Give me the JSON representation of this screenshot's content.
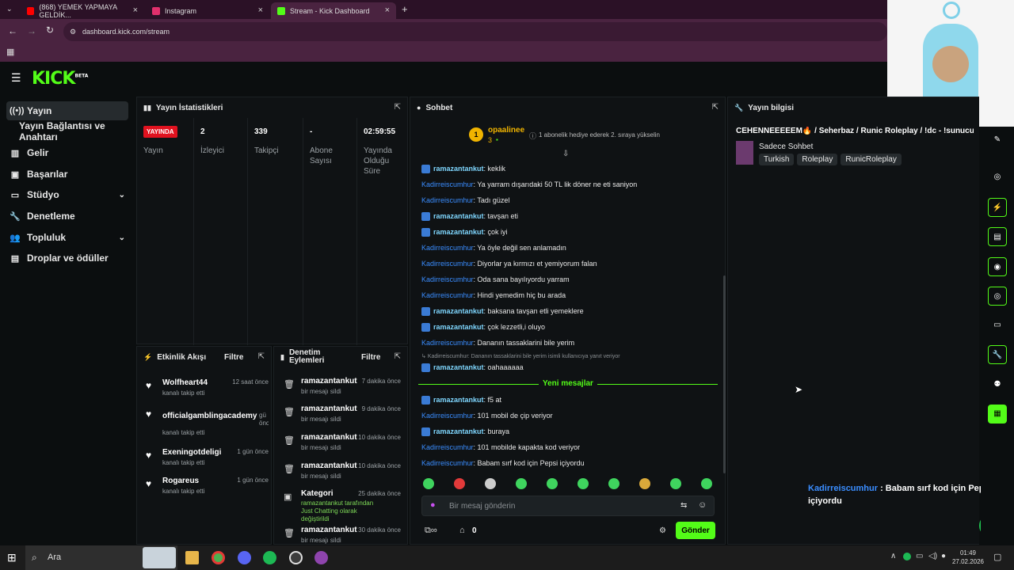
{
  "browser": {
    "tabs": [
      {
        "title": "(868) YEMEK YAPMAYA GELDİK...",
        "icon": "youtube-icon",
        "color": "#ff0000"
      },
      {
        "title": "Instagram",
        "icon": "instagram-icon",
        "color": "#e1306c"
      },
      {
        "title": "Stream - Kick Dashboard",
        "icon": "kick-icon",
        "color": "#53fc18"
      }
    ],
    "url": "dashboard.kick.com/stream"
  },
  "kick": {
    "logo": "KICK",
    "beta": "BETA"
  },
  "sidebar": {
    "items": [
      {
        "label": "Yayın",
        "icon": "broadcast-icon"
      },
      {
        "label": "Yayın Bağlantısı ve Anahtarı",
        "icon": ""
      },
      {
        "label": "Gelir",
        "icon": "bank-icon"
      },
      {
        "label": "Başarılar",
        "icon": "trophy-icon"
      },
      {
        "label": "Stüdyo",
        "icon": "monitor-icon"
      },
      {
        "label": "Denetleme",
        "icon": "wrench-icon"
      },
      {
        "label": "Topluluk",
        "icon": "users-icon"
      },
      {
        "label": "Droplar ve ödüller",
        "icon": "gift-icon"
      }
    ]
  },
  "stats": {
    "title": "Yayın İstatistikleri",
    "live_badge": "YAYINDA",
    "live_label": "Yayın",
    "items": [
      {
        "value": "2",
        "label": "İzleyici"
      },
      {
        "value": "339",
        "label": "Takipçi"
      },
      {
        "value": "-",
        "label": "Abone Sayısı"
      },
      {
        "value": "02:59:55",
        "label": "Yayında Olduğu Süre"
      }
    ]
  },
  "activity": {
    "title": "Etkinlik Akışı",
    "filter": "Filtre",
    "items": [
      {
        "name": "Wolfheart44",
        "sub": "kanalı takip etti",
        "time": "12 saat önce"
      },
      {
        "name": "officialgamblingacademy",
        "sub": "kanalı takip etti",
        "time": "gü önc"
      },
      {
        "name": "Exeningotdeligi",
        "sub": "kanalı takip etti",
        "time": "1 gün önce"
      },
      {
        "name": "Rogareus",
        "sub": "kanalı takip etti",
        "time": "1 gün önce"
      }
    ]
  },
  "moderation": {
    "title": "Denetim Eylemleri",
    "filter": "Filtre",
    "items": [
      {
        "name": "ramazantankut",
        "sub": "bir mesajı sildi",
        "time": "7 dakika önce"
      },
      {
        "name": "ramazantankut",
        "sub": "bir mesajı sildi",
        "time": "9 dakika önce"
      },
      {
        "name": "ramazantankut",
        "sub": "bir mesajı sildi",
        "time": "10 dakika önce"
      },
      {
        "name": "ramazantankut",
        "sub": "bir mesajı sildi",
        "time": "10 dakika önce"
      },
      {
        "name": "Kategori",
        "sub": "ramazantankut tarafından Just Chatting olarak değiştirildi",
        "time": "25 dakika önce"
      },
      {
        "name": "ramazantankut",
        "sub": "bir mesajı sildi",
        "time": "30 dakika önce"
      }
    ]
  },
  "chat": {
    "title": "Sohbet",
    "top_user": "opaalinee",
    "top_rank": "1",
    "top_count": "3",
    "top_note": "1 abonelik hediye ederek 2. sıraya yükselin",
    "messages": [
      {
        "user": "ramazantankut",
        "text": ": keklik",
        "mod": true
      },
      {
        "user": "Kadirreiscumhur",
        "text": ": Ya yarram dışarıdaki 50 TL lik döner ne eti saniyon",
        "mod": false
      },
      {
        "user": "Kadirreiscumhur",
        "text": ": Tadı güzel",
        "mod": false
      },
      {
        "user": "ramazantankut",
        "text": ": tavşan eti",
        "mod": true
      },
      {
        "user": "ramazantankut",
        "text": ": çok iyi",
        "mod": true
      },
      {
        "user": "Kadirreiscumhur",
        "text": ": Ya öyle değil sen anlamadın",
        "mod": false
      },
      {
        "user": "Kadirreiscumhur",
        "text": ": Diyorlar ya kırmızı et yemiyorum falan",
        "mod": false
      },
      {
        "user": "Kadirreiscumhur",
        "text": ": Oda sana bayılıyordu yarram",
        "mod": false
      },
      {
        "user": "Kadirreiscumhur",
        "text": ": Hindi yemedim hiç bu arada",
        "mod": false
      },
      {
        "user": "ramazantankut",
        "text": ": baksana tavşan etli yemeklere",
        "mod": true
      },
      {
        "user": "ramazantankut",
        "text": ": çok lezzetli,i oluyo",
        "mod": true
      },
      {
        "user": "Kadirreiscumhur",
        "text": ": Dananın tassaklarini bile yerim",
        "mod": false
      }
    ],
    "reply_context": "Kadirreiscumhur: Dananın tassaklarini bile yerim isimli kullanıcıya yanıt veriyor",
    "reply": {
      "user": "ramazantankut",
      "text": ": oahaaaaaa"
    },
    "new_messages_label": "Yeni mesajlar",
    "new_messages": [
      {
        "user": "ramazantankut",
        "text": ": f5 at",
        "mod": true
      },
      {
        "user": "Kadirreiscumhur",
        "text": ": 101 mobil de çip veriyor",
        "mod": false
      },
      {
        "user": "ramazantankut",
        "text": ": buraya",
        "mod": true
      },
      {
        "user": "Kadirreiscumhur",
        "text": ": 101 mobilde kapakta kod veriyor",
        "mod": false
      },
      {
        "user": "Kadirreiscumhur",
        "text": ": Babam sırf kod için Pepsi içiyordu",
        "mod": false
      }
    ],
    "input_placeholder": "Bir mesaj gönderin",
    "points": "0",
    "send_label": "Gönder"
  },
  "stream_info": {
    "title": "Yayın bilgisi",
    "stream_title": "CEHENNEEEEEM🔥 / Seherbaz / Runic Roleplay / !dc - !sunucu",
    "category": "Sadece Sohbet",
    "tags": [
      "Turkish",
      "Roleplay",
      "RunicRoleplay"
    ]
  },
  "overlay": {
    "user": "Kadirreiscumhur",
    "text": " : Babam sırf kod için Pepsi içiyordu"
  },
  "taskbar": {
    "search": "Ara",
    "time": "01:49",
    "date": "27.02.2026"
  }
}
